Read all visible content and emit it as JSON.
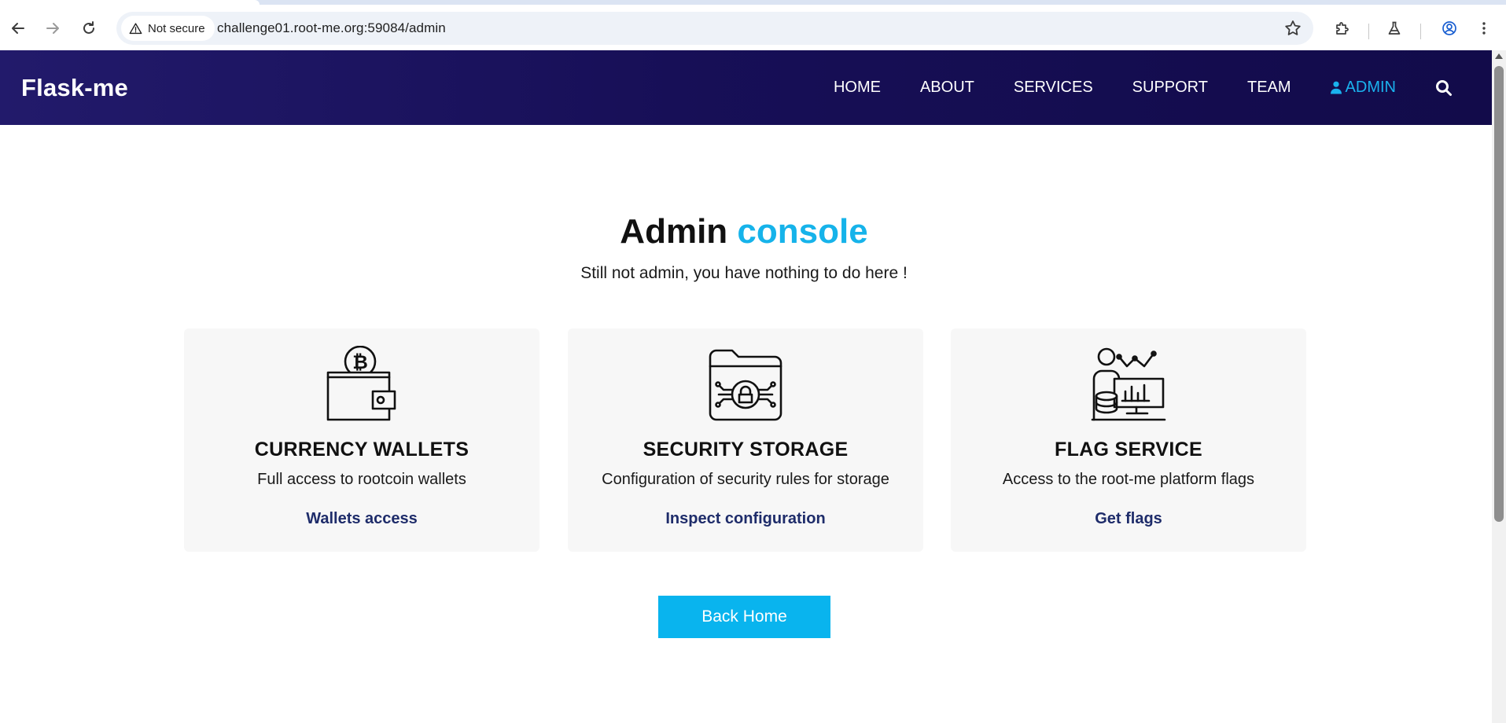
{
  "browser": {
    "security_label": "Not secure",
    "url": "challenge01.root-me.org:59084/admin"
  },
  "site": {
    "brand": "Flask-me",
    "nav": [
      {
        "label": "HOME"
      },
      {
        "label": "ABOUT"
      },
      {
        "label": "SERVICES"
      },
      {
        "label": "SUPPORT"
      },
      {
        "label": "TEAM"
      },
      {
        "label": "ADMIN",
        "active": true
      }
    ]
  },
  "main": {
    "title_part1": "Admin",
    "title_part2": "console",
    "subtitle": "Still not admin, you have nothing to do here !",
    "cards": [
      {
        "icon": "bitcoin-wallet-icon",
        "title": "CURRENCY WALLETS",
        "description": "Full access to rootcoin wallets",
        "link": "Wallets access"
      },
      {
        "icon": "secure-folder-icon",
        "title": "SECURITY STORAGE",
        "description": "Configuration of security rules for storage",
        "link": "Inspect configuration"
      },
      {
        "icon": "data-analyst-icon",
        "title": "FLAG SERVICE",
        "description": "Access to the root-me platform flags",
        "link": "Get flags"
      }
    ],
    "back_button": "Back Home"
  },
  "colors": {
    "header_bg": "#170f57",
    "accent": "#16b3ea",
    "button_bg": "#09b4ee",
    "link": "#1e2c6a",
    "card_bg": "#f7f7f7"
  }
}
